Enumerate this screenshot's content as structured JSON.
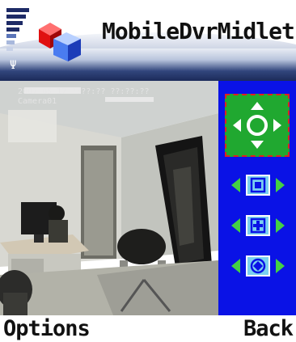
{
  "app": {
    "title": "MobileDvrMidlet"
  },
  "status": {
    "signal_icon": "signal-strength-icon",
    "antenna_glyph": "Ψ"
  },
  "video": {
    "timestamp": "2007-05-17 ?:??:?? ??:??:??",
    "camera": "Camera01"
  },
  "controls": {
    "dpad_icon": "ptz-direction-icon",
    "zoom_icon": "zoom-icon",
    "focus_icon": "focus-icon",
    "iris_icon": "iris-icon"
  },
  "softkeys": {
    "left_label": "Options",
    "right_label": "Back"
  },
  "colors": {
    "panel_blue": "#0a12e6",
    "dpad_green": "#20a830",
    "selection_red": "#e02020",
    "arrow_green": "#44d044",
    "button_cyan": "#7ad0f0"
  }
}
